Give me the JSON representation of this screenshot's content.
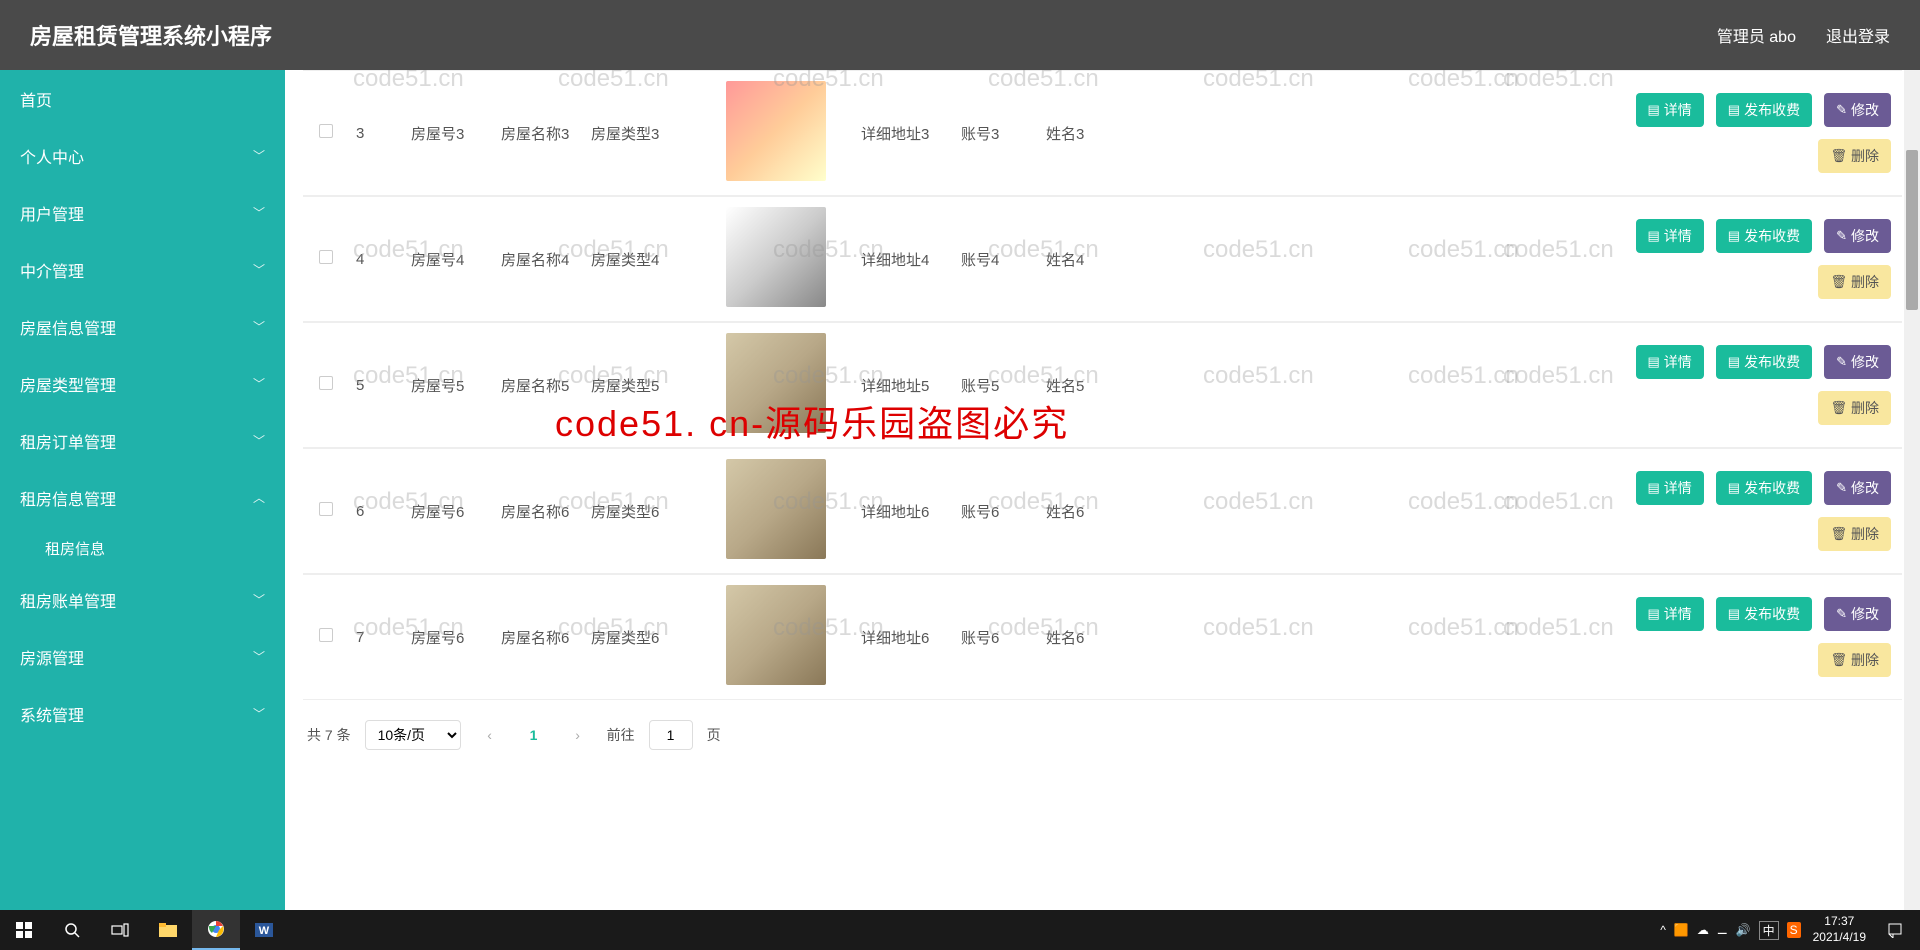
{
  "header": {
    "title": "房屋租赁管理系统小程序",
    "user": "管理员 abo",
    "logout": "退出登录"
  },
  "sidebar": {
    "items": [
      {
        "label": "首页",
        "expandable": false
      },
      {
        "label": "个人中心",
        "expandable": true,
        "icon": "down"
      },
      {
        "label": "用户管理",
        "expandable": true,
        "icon": "down"
      },
      {
        "label": "中介管理",
        "expandable": true,
        "icon": "down"
      },
      {
        "label": "房屋信息管理",
        "expandable": true,
        "icon": "down"
      },
      {
        "label": "房屋类型管理",
        "expandable": true,
        "icon": "down"
      },
      {
        "label": "租房订单管理",
        "expandable": true,
        "icon": "down"
      },
      {
        "label": "租房信息管理",
        "expandable": true,
        "icon": "up",
        "children": [
          {
            "label": "租房信息"
          }
        ]
      },
      {
        "label": "租房账单管理",
        "expandable": true,
        "icon": "down"
      },
      {
        "label": "房源管理",
        "expandable": true,
        "icon": "down"
      },
      {
        "label": "系统管理",
        "expandable": true,
        "icon": "down"
      }
    ]
  },
  "rows": [
    {
      "idx": "3",
      "houseno": "房屋号3",
      "housename": "房屋名称3",
      "housetype": "房屋类型3",
      "address": "详细地址3",
      "account": "账号3",
      "name": "姓名3",
      "thumbClass": "t3"
    },
    {
      "idx": "4",
      "houseno": "房屋号4",
      "housename": "房屋名称4",
      "housetype": "房屋类型4",
      "address": "详细地址4",
      "account": "账号4",
      "name": "姓名4",
      "thumbClass": "t4"
    },
    {
      "idx": "5",
      "houseno": "房屋号5",
      "housename": "房屋名称5",
      "housetype": "房屋类型5",
      "address": "详细地址5",
      "account": "账号5",
      "name": "姓名5",
      "thumbClass": ""
    },
    {
      "idx": "6",
      "houseno": "房屋号6",
      "housename": "房屋名称6",
      "housetype": "房屋类型6",
      "address": "详细地址6",
      "account": "账号6",
      "name": "姓名6",
      "thumbClass": ""
    },
    {
      "idx": "7",
      "houseno": "房屋号6",
      "housename": "房屋名称6",
      "housetype": "房屋类型6",
      "address": "详细地址6",
      "account": "账号6",
      "name": "姓名6",
      "thumbClass": ""
    }
  ],
  "actions": {
    "detail": "详情",
    "publish": "发布收费",
    "edit": "修改",
    "delete": "删除"
  },
  "pagination": {
    "total": "共 7 条",
    "perpage": "10条/页",
    "current": "1",
    "goto": "前往",
    "gotoValue": "1",
    "pageSuffix": "页"
  },
  "overlay": "code51. cn-源码乐园盗图必究",
  "watermark": "code51.cn",
  "taskbar": {
    "time": "17:37",
    "date": "2021/4/19",
    "ime": "中"
  }
}
